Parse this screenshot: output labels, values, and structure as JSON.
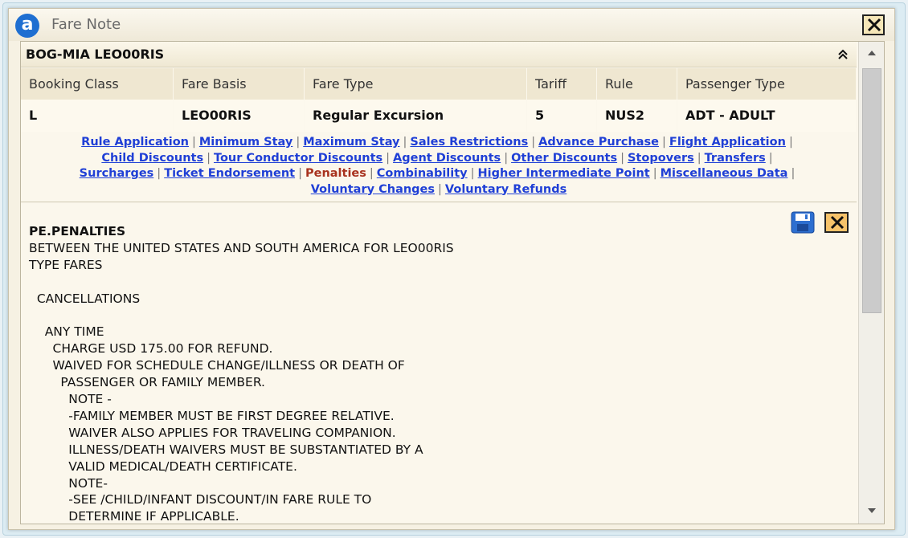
{
  "window": {
    "title": "Fare Note",
    "logo_letter": "a"
  },
  "fare": {
    "route_title": "BOG-MIA LEO00RIS",
    "columns": [
      "Booking Class",
      "Fare Basis",
      "Fare Type",
      "Tariff",
      "Rule",
      "Passenger Type"
    ],
    "values": [
      "L",
      "LEO00RIS",
      "Regular Excursion",
      "5",
      "NUS2",
      "ADT - ADULT"
    ]
  },
  "rule_links": [
    {
      "label": "Rule Application"
    },
    {
      "label": "Minimum Stay"
    },
    {
      "label": "Maximum Stay"
    },
    {
      "label": "Sales Restrictions"
    },
    {
      "label": "Advance Purchase"
    },
    {
      "label": "Flight Application"
    },
    {
      "label": "Child Discounts"
    },
    {
      "label": "Tour Conductor Discounts"
    },
    {
      "label": "Agent Discounts"
    },
    {
      "label": "Other Discounts"
    },
    {
      "label": "Stopovers"
    },
    {
      "label": "Transfers"
    },
    {
      "label": "Surcharges"
    },
    {
      "label": "Ticket Endorsement"
    },
    {
      "label": "Penalties",
      "active": true
    },
    {
      "label": "Combinability"
    },
    {
      "label": "Higher Intermediate Point"
    },
    {
      "label": "Miscellaneous Data"
    },
    {
      "label": "Voluntary Changes"
    },
    {
      "label": "Voluntary Refunds"
    }
  ],
  "content": {
    "section_title": "PE.PENALTIES",
    "lines": [
      "BETWEEN THE UNITED STATES AND SOUTH AMERICA FOR LEO00RIS",
      "TYPE FARES",
      "",
      "  CANCELLATIONS",
      "",
      "    ANY TIME",
      "      CHARGE USD 175.00 FOR REFUND.",
      "      WAIVED FOR SCHEDULE CHANGE/ILLNESS OR DEATH OF",
      "        PASSENGER OR FAMILY MEMBER.",
      "          NOTE -",
      "          -FAMILY MEMBER MUST BE FIRST DEGREE RELATIVE.",
      "          WAIVER ALSO APPLIES FOR TRAVELING COMPANION.",
      "          ILLNESS/DEATH WAIVERS MUST BE SUBSTANTIATED BY A",
      "          VALID MEDICAL/DEATH CERTIFICATE.",
      "          NOTE-",
      "          -SEE /CHILD/INFANT DISCOUNT/IN FARE RULE TO",
      "          DETERMINE IF APPLICABLE."
    ]
  },
  "colors": {
    "link": "#1f3fd6",
    "active_link": "#a8321e",
    "logo": "#1f6fd1",
    "panel_bg": "#fbf7ec"
  }
}
